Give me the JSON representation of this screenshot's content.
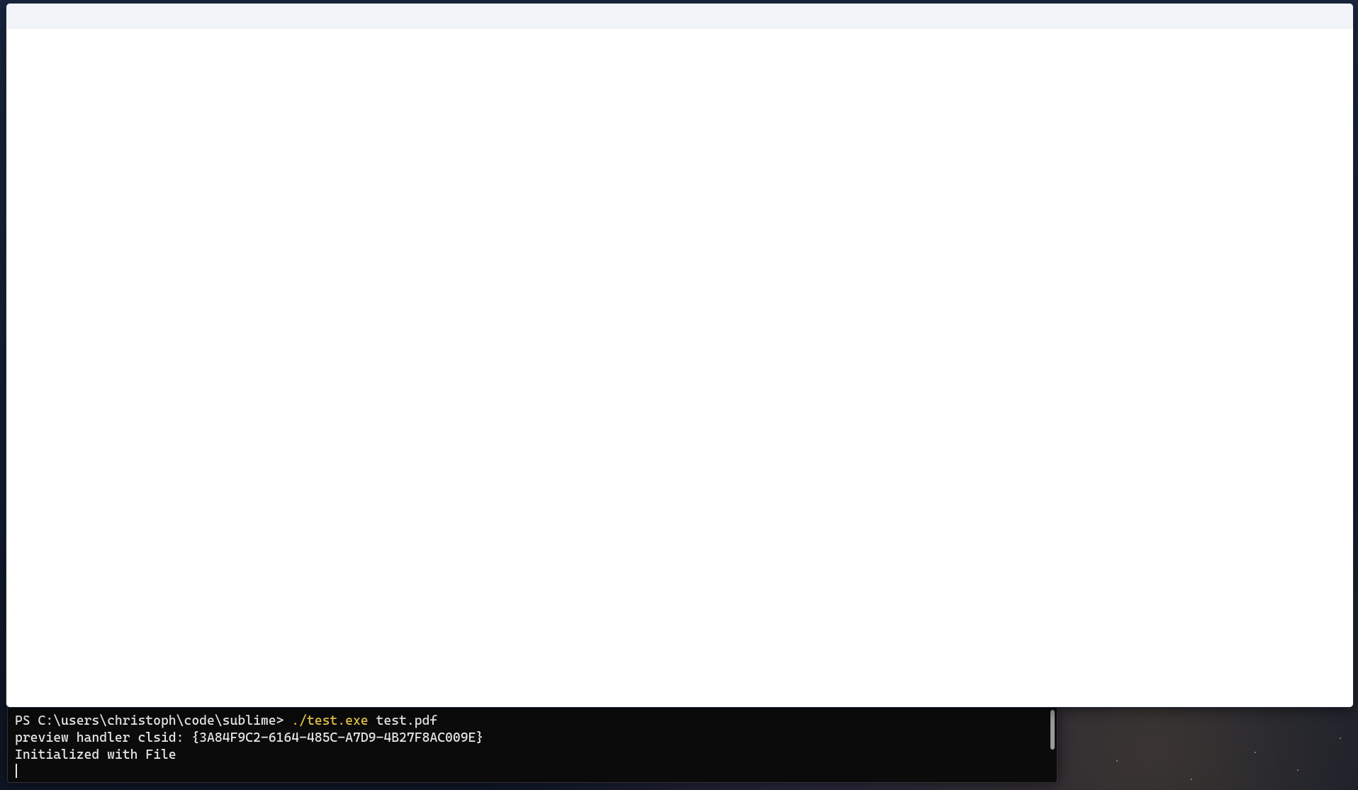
{
  "terminal": {
    "prompt": "PS C:\\users\\christoph\\code\\sublime> ",
    "command": "./test.exe",
    "argument": " test.pdf",
    "output_lines": [
      "preview handler clsid: {3A84F9C2-6164-485C-A7D9-4B27F8AC009E}",
      "Initialized with File"
    ]
  },
  "app_window": {
    "title": ""
  }
}
